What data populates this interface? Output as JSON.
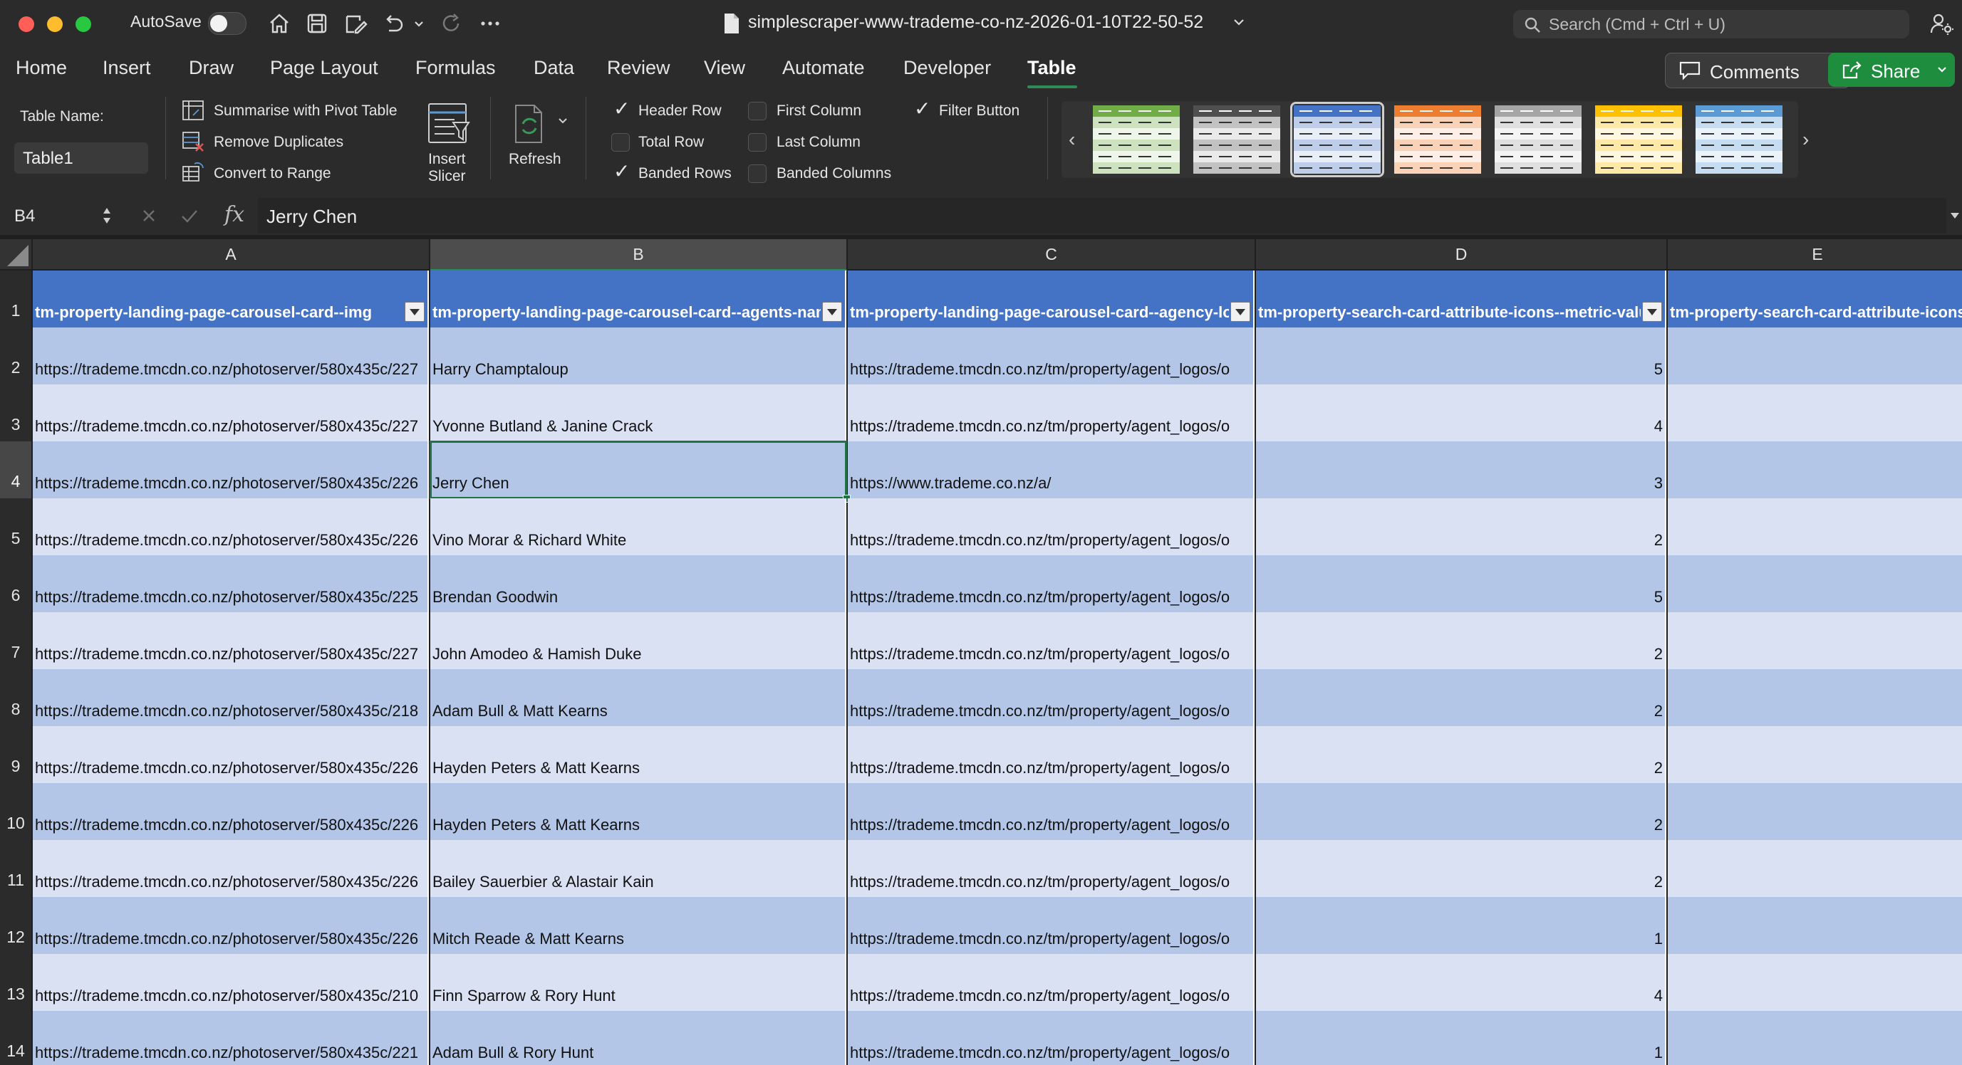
{
  "titlebar": {
    "autosave_label": "AutoSave",
    "document_title": "simplescraper-www-trademe-co-nz-2026-01-10T22-50-52",
    "search_placeholder": "Search (Cmd + Ctrl + U)"
  },
  "tabs": [
    "Home",
    "Insert",
    "Draw",
    "Page Layout",
    "Formulas",
    "Data",
    "Review",
    "View",
    "Automate",
    "Developer",
    "Table"
  ],
  "active_tab": "Table",
  "buttons": {
    "comments": "Comments",
    "share": "Share"
  },
  "ribbon": {
    "table_name_label": "Table Name:",
    "table_name_value": "Table1",
    "tools": [
      "Summarise with Pivot Table",
      "Remove Duplicates",
      "Convert to Range"
    ],
    "insert_slicer": [
      "Insert",
      "Slicer"
    ],
    "refresh": "Refresh",
    "options": [
      {
        "label": "Header Row",
        "checked": true
      },
      {
        "label": "Total Row",
        "checked": false
      },
      {
        "label": "Banded Rows",
        "checked": true
      },
      {
        "label": "First Column",
        "checked": false
      },
      {
        "label": "Last Column",
        "checked": false
      },
      {
        "label": "Banded Columns",
        "checked": false
      },
      {
        "label": "Filter Button",
        "checked": true
      }
    ],
    "table_styles": [
      {
        "color": "#70ad47",
        "selected": false
      },
      {
        "color": "#4f4f4f",
        "selected": false
      },
      {
        "color": "#4472c4",
        "selected": true
      },
      {
        "color": "#ed7d31",
        "selected": false
      },
      {
        "color": "#a5a5a5",
        "selected": false
      },
      {
        "color": "#ffc000",
        "selected": false
      },
      {
        "color": "#5b9bd5",
        "selected": false
      }
    ]
  },
  "formula_bar": {
    "cell_ref": "B4",
    "fx": "fx",
    "value": "Jerry Chen"
  },
  "sheet": {
    "columns": [
      "A",
      "B",
      "C",
      "D",
      "E"
    ],
    "selected_column": "B",
    "selected_row": 4,
    "headers": [
      "tm-property-landing-page-carousel-card--img",
      "tm-property-landing-page-carousel-card--agents-name",
      "tm-property-landing-page-carousel-card--agency-logo",
      "tm-property-search-card-attribute-icons--metric-value",
      "tm-property-search-card-attribute-icons--"
    ],
    "rows": [
      {
        "n": "2",
        "a": "https://trademe.tmcdn.co.nz/photoserver/580x435c/227",
        "b": "Harry Champtaloup",
        "c": "https://trademe.tmcdn.co.nz/tm/property/agent_logos/o",
        "d": "5"
      },
      {
        "n": "3",
        "a": "https://trademe.tmcdn.co.nz/photoserver/580x435c/227",
        "b": "Yvonne Butland & Janine Crack",
        "c": "https://trademe.tmcdn.co.nz/tm/property/agent_logos/o",
        "d": "4"
      },
      {
        "n": "4",
        "a": "https://trademe.tmcdn.co.nz/photoserver/580x435c/226",
        "b": "Jerry Chen",
        "c": "https://www.trademe.co.nz/a/",
        "d": "3"
      },
      {
        "n": "5",
        "a": "https://trademe.tmcdn.co.nz/photoserver/580x435c/226",
        "b": "Vino Morar & Richard White",
        "c": "https://trademe.tmcdn.co.nz/tm/property/agent_logos/o",
        "d": "2"
      },
      {
        "n": "6",
        "a": "https://trademe.tmcdn.co.nz/photoserver/580x435c/225",
        "b": "Brendan Goodwin",
        "c": "https://trademe.tmcdn.co.nz/tm/property/agent_logos/o",
        "d": "5"
      },
      {
        "n": "7",
        "a": "https://trademe.tmcdn.co.nz/photoserver/580x435c/227",
        "b": "John Amodeo & Hamish Duke",
        "c": "https://trademe.tmcdn.co.nz/tm/property/agent_logos/o",
        "d": "2"
      },
      {
        "n": "8",
        "a": "https://trademe.tmcdn.co.nz/photoserver/580x435c/218",
        "b": "Adam Bull & Matt Kearns",
        "c": "https://trademe.tmcdn.co.nz/tm/property/agent_logos/o",
        "d": "2"
      },
      {
        "n": "9",
        "a": "https://trademe.tmcdn.co.nz/photoserver/580x435c/226",
        "b": "Hayden Peters & Matt Kearns",
        "c": "https://trademe.tmcdn.co.nz/tm/property/agent_logos/o",
        "d": "2"
      },
      {
        "n": "10",
        "a": "https://trademe.tmcdn.co.nz/photoserver/580x435c/226",
        "b": "Hayden Peters & Matt Kearns",
        "c": "https://trademe.tmcdn.co.nz/tm/property/agent_logos/o",
        "d": "2"
      },
      {
        "n": "11",
        "a": "https://trademe.tmcdn.co.nz/photoserver/580x435c/226",
        "b": "Bailey Sauerbier & Alastair Kain",
        "c": "https://trademe.tmcdn.co.nz/tm/property/agent_logos/o",
        "d": "2"
      },
      {
        "n": "12",
        "a": "https://trademe.tmcdn.co.nz/photoserver/580x435c/226",
        "b": "Mitch Reade & Matt Kearns",
        "c": "https://trademe.tmcdn.co.nz/tm/property/agent_logos/o",
        "d": "1"
      },
      {
        "n": "13",
        "a": "https://trademe.tmcdn.co.nz/photoserver/580x435c/210",
        "b": "Finn Sparrow & Rory Hunt",
        "c": "https://trademe.tmcdn.co.nz/tm/property/agent_logos/o",
        "d": "4"
      },
      {
        "n": "14",
        "a": "https://trademe.tmcdn.co.nz/photoserver/580x435c/221",
        "b": "Adam Bull & Rory Hunt",
        "c": "https://trademe.tmcdn.co.nz/tm/property/agent_logos/o",
        "d": "1"
      }
    ]
  }
}
